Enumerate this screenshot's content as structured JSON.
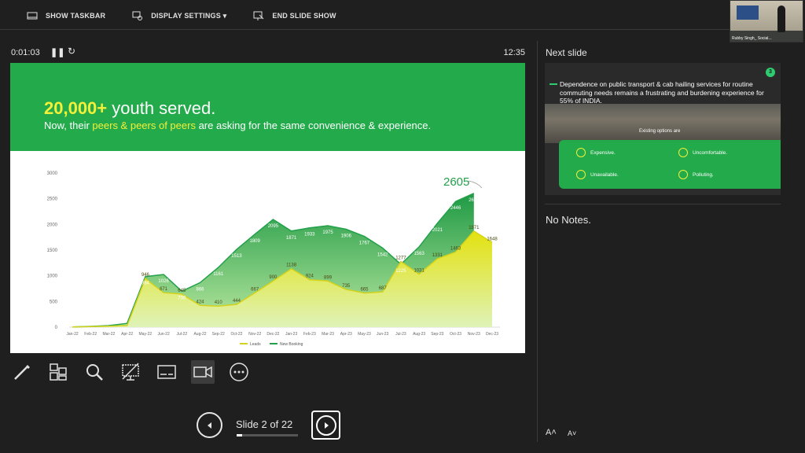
{
  "toolbar": {
    "show_taskbar": "SHOW TASKBAR",
    "display_settings": "DISPLAY SETTINGS ▾",
    "end_slide_show": "END SLIDE SHOW"
  },
  "webcam": {
    "name": "Rubby Singh_ Social..."
  },
  "presenter": {
    "elapsed": "0:01:03",
    "clock": "12:35",
    "next_slide_label": "Next slide",
    "notes": "No Notes.",
    "font_increase": "A˄",
    "font_decrease": "A˅"
  },
  "navigation": {
    "slide_text": "Slide 2 of 22",
    "current": 2,
    "total": 22
  },
  "slide": {
    "title_number": "20,000+",
    "title_rest": " youth served.",
    "subtitle_1": "Now, their ",
    "subtitle_hl": "peers & peers of peers",
    "subtitle_2": " are asking for the same convenience & experience."
  },
  "next_slide": {
    "number": "3",
    "text": "Dependence on public transport & cab hailing services for routine commuting needs remains a frustrating and burdening experience for 55% of INDIA.",
    "existing": "Existing options are",
    "options": [
      "Expensive.",
      "Uncomfortable.",
      "Unavailable.",
      "Polluting."
    ]
  },
  "icons": [
    "taskbar-icon",
    "display-icon",
    "end-show-icon",
    "pause-icon",
    "restart-icon",
    "pen-icon",
    "grid-icon",
    "zoom-icon",
    "pointer-off-icon",
    "subtitles-icon",
    "camera-icon",
    "more-icon",
    "prev-icon",
    "next-icon"
  ],
  "colors": {
    "slide_green": "#22aa4b",
    "highlight_yellow": "#f3f03a",
    "leads": "#d4d21a",
    "new_booking": "#22a04a",
    "bg": "#1f1f1f"
  },
  "chart_data": {
    "type": "area",
    "categories": [
      "Jan-22",
      "Feb-22",
      "Mar-22",
      "Apr-22",
      "May-22",
      "Jun-22",
      "Jul-22",
      "Aug-22",
      "Sep-22",
      "Oct-22",
      "Nov-22",
      "Dec-22",
      "Jan-23",
      "Feb-23",
      "Mar-23",
      "Apr-23",
      "May-23",
      "Jun-23",
      "Jul-23",
      "Aug-23",
      "Sep-23",
      "Oct-23",
      "Nov-23",
      "Dec-23"
    ],
    "series": [
      {
        "name": "Leads",
        "values": [
          5,
          10,
          20,
          30,
          946,
          671,
          645,
          424,
          410,
          444,
          667,
          900,
          1138,
          924,
          899,
          735,
          665,
          687,
          1277,
          1031,
          1331,
          1463,
          1871,
          1648
        ]
      },
      {
        "name": "New Booking",
        "values": [
          5,
          15,
          30,
          74,
          984,
          1026,
          700,
          866,
          1161,
          1513,
          1809,
          2095,
          1871,
          1933,
          1975,
          1906,
          1767,
          1542,
          1225,
          1563,
          2021,
          2446,
          2605
        ]
      }
    ],
    "labels": {
      "leads": [
        "",
        "",
        "",
        "",
        "946",
        "671",
        "645",
        "424",
        "410",
        "444",
        "667",
        "900",
        "1138",
        "924",
        "899",
        "735",
        "665",
        "687",
        "1277",
        "1031",
        "1331",
        "1463",
        "1871",
        "1648"
      ],
      "booking": [
        "",
        "",
        "",
        "74",
        "984",
        "1026",
        "700",
        "866",
        "1161",
        "1513",
        "1809",
        "2095",
        "1871",
        "1933",
        "1975",
        "1906",
        "1767",
        "1542",
        "1225",
        "1563",
        "2021",
        "2446",
        "2605",
        ""
      ]
    },
    "callout": "2605",
    "ylim": [
      0,
      3000
    ],
    "yticks": [
      0,
      500,
      1000,
      1500,
      2000,
      2500,
      3000
    ],
    "legend": [
      "Leads",
      "New Booking"
    ],
    "legend_position": "bottom",
    "grid": false
  }
}
